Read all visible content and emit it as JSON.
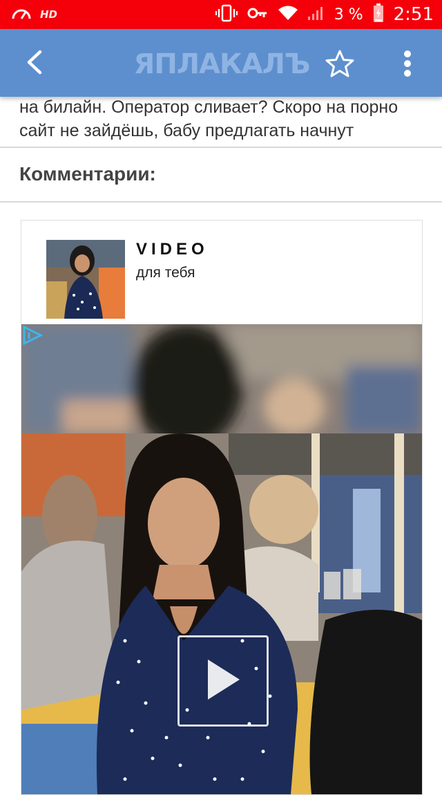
{
  "status_bar": {
    "hd_label": "HD",
    "battery_percent": "3 %",
    "time": "2:51"
  },
  "app_bar": {
    "logo_text": "ЯПЛАКАЛЪ"
  },
  "post": {
    "text": "на билайн. Оператор сливает? Скоро на порно сайт не зайдёшь, бабу предлагать начнут"
  },
  "comments": {
    "label": "Комментарии:"
  },
  "ad": {
    "title": "VIDEO",
    "subtitle": "для тебя"
  },
  "icons": [
    "speedometer-icon",
    "vibrate-icon",
    "key-icon",
    "wifi-icon",
    "signal-icon",
    "battery-icon",
    "back-icon",
    "star-icon",
    "more-vert-icon",
    "adchoices-icon",
    "play-icon"
  ],
  "colors": {
    "status_bar": "#f5000a",
    "app_bar": "#5d8fce",
    "logo": "#8fb4e3"
  }
}
